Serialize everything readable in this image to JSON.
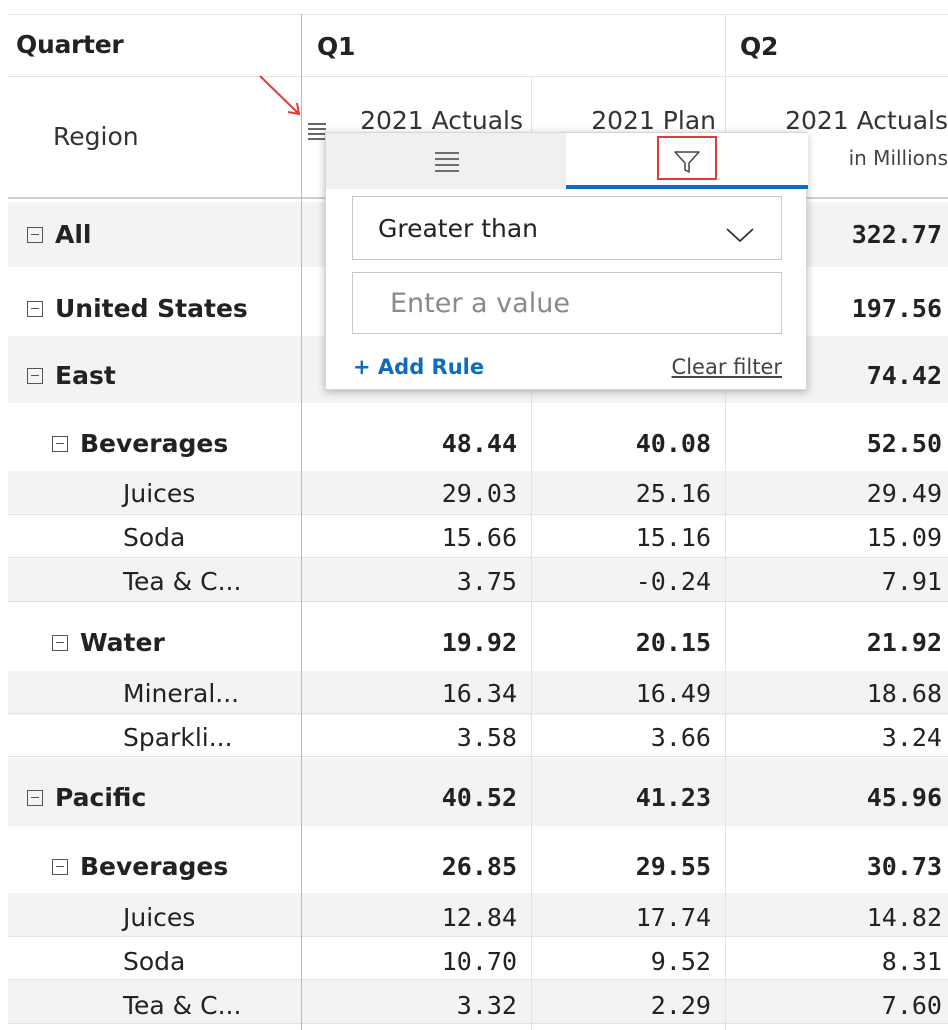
{
  "header": {
    "quarter_label": "Quarter",
    "q1_label": "Q1",
    "q2_label": "Q2",
    "region_label": "Region",
    "col1_label": "2021 Actuals",
    "col2_label": "2021 Plan",
    "col3_label": "2021 Actuals",
    "col3_sub": "in Millions"
  },
  "rows": [
    {
      "label": "All",
      "level": 0,
      "bold": true,
      "q2a": "322.77"
    },
    {
      "label": "United States",
      "level": 0,
      "bold": true,
      "q2a": "197.56"
    },
    {
      "label": "East",
      "level": 1,
      "bold": true,
      "q2a": "74.42"
    },
    {
      "label": "Beverages",
      "level": 2,
      "bold": true,
      "q1a": "48.44",
      "q1p": "40.08",
      "q2a": "52.50"
    },
    {
      "label": "Juices",
      "level": 3,
      "bold": false,
      "q1a": "29.03",
      "q1p": "25.16",
      "q2a": "29.49"
    },
    {
      "label": "Soda",
      "level": 3,
      "bold": false,
      "q1a": "15.66",
      "q1p": "15.16",
      "q2a": "15.09"
    },
    {
      "label": "Tea & C...",
      "level": 3,
      "bold": false,
      "q1a": "3.75",
      "q1p": "-0.24",
      "q2a": "7.91"
    },
    {
      "label": "Water",
      "level": 2,
      "bold": true,
      "q1a": "19.92",
      "q1p": "20.15",
      "q2a": "21.92"
    },
    {
      "label": "Mineral...",
      "level": 3,
      "bold": false,
      "q1a": "16.34",
      "q1p": "16.49",
      "q2a": "18.68"
    },
    {
      "label": "Sparkli...",
      "level": 3,
      "bold": false,
      "q1a": "3.58",
      "q1p": "3.66",
      "q2a": "3.24"
    },
    {
      "label": "Pacific",
      "level": 1,
      "bold": true,
      "q1a": "40.52",
      "q1p": "41.23",
      "q2a": "45.96"
    },
    {
      "label": "Beverages",
      "level": 2,
      "bold": true,
      "q1a": "26.85",
      "q1p": "29.55",
      "q2a": "30.73"
    },
    {
      "label": "Juices",
      "level": 3,
      "bold": false,
      "q1a": "12.84",
      "q1p": "17.74",
      "q2a": "14.82"
    },
    {
      "label": "Soda",
      "level": 3,
      "bold": false,
      "q1a": "10.70",
      "q1p": "9.52",
      "q2a": "8.31"
    },
    {
      "label": "Tea & C...",
      "level": 3,
      "bold": false,
      "q1a": "3.32",
      "q1p": "2.29",
      "q2a": "7.60"
    }
  ],
  "popup": {
    "tab_list_icon": "list-lines-icon",
    "tab_filter_icon": "funnel-icon",
    "operator": "Greater than",
    "value_placeholder": "Enter a value",
    "add_rule": "+ Add Rule",
    "clear_filter": "Clear filter"
  },
  "colors": {
    "accent": "#0f6cbd",
    "highlight": "#e53935",
    "band": "#f3f3f3"
  }
}
